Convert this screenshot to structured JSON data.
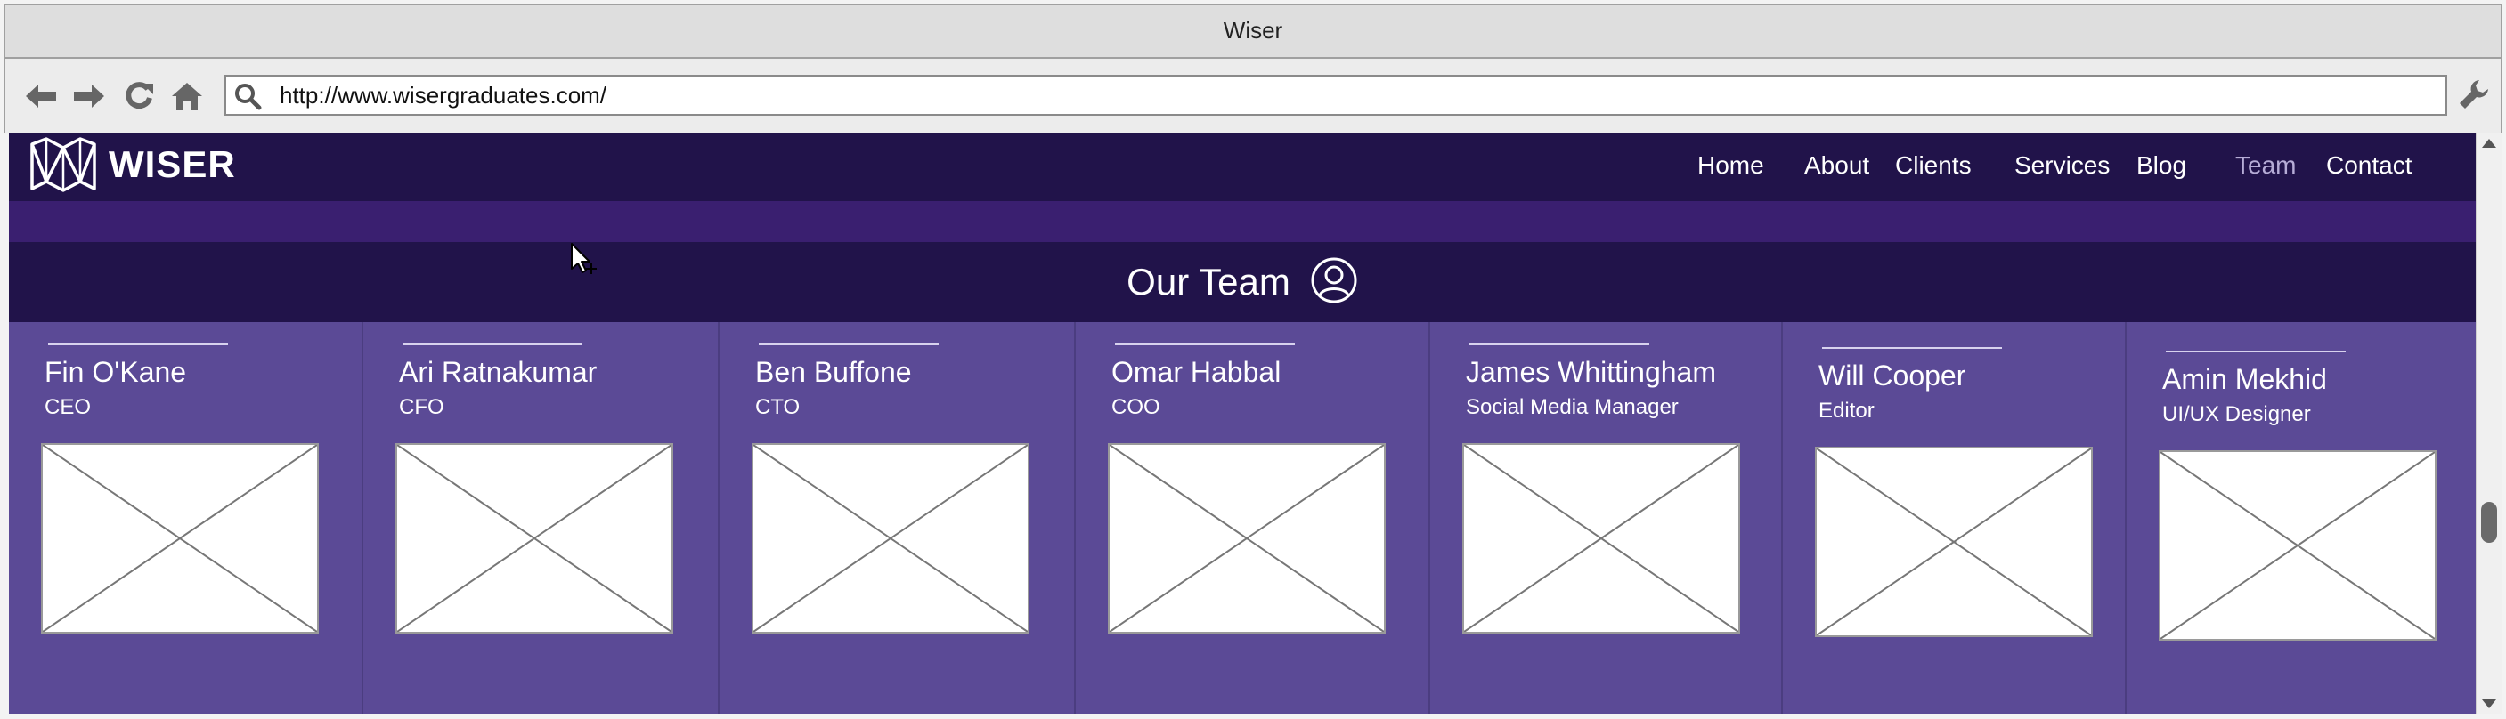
{
  "window": {
    "title": "Wiser"
  },
  "toolbar": {
    "url": "http://www.wisergraduates.com/",
    "icons": {
      "back": "back-arrow-icon",
      "forward": "forward-arrow-icon",
      "reload": "reload-icon",
      "home": "home-icon",
      "search": "search-icon",
      "settings": "wrench-icon"
    }
  },
  "site": {
    "logo_text": "WISER",
    "nav": [
      {
        "label": "Home"
      },
      {
        "label": "About"
      },
      {
        "label": "Clients"
      },
      {
        "label": "Services"
      },
      {
        "label": "Blog"
      },
      {
        "label": "Team"
      },
      {
        "label": "Contact"
      }
    ],
    "active_nav": "Team",
    "section_title": "Our Team",
    "colors": {
      "header": "#21134a",
      "band": "#3a1f70",
      "grid": "#5b4a96",
      "active_link": "#b6acd6"
    }
  },
  "team": [
    {
      "name": "Fin O'Kane",
      "role": "CEO"
    },
    {
      "name": "Ari Ratnakumar",
      "role": "CFO"
    },
    {
      "name": "Ben Buffone",
      "role": "CTO"
    },
    {
      "name": "Omar Habbal",
      "role": "COO"
    },
    {
      "name": "James Whittingham",
      "role": "Social Media Manager"
    },
    {
      "name": "Will Cooper",
      "role": "Editor"
    },
    {
      "name": "Amin Mekhid",
      "role": "UI/UX Designer"
    }
  ]
}
